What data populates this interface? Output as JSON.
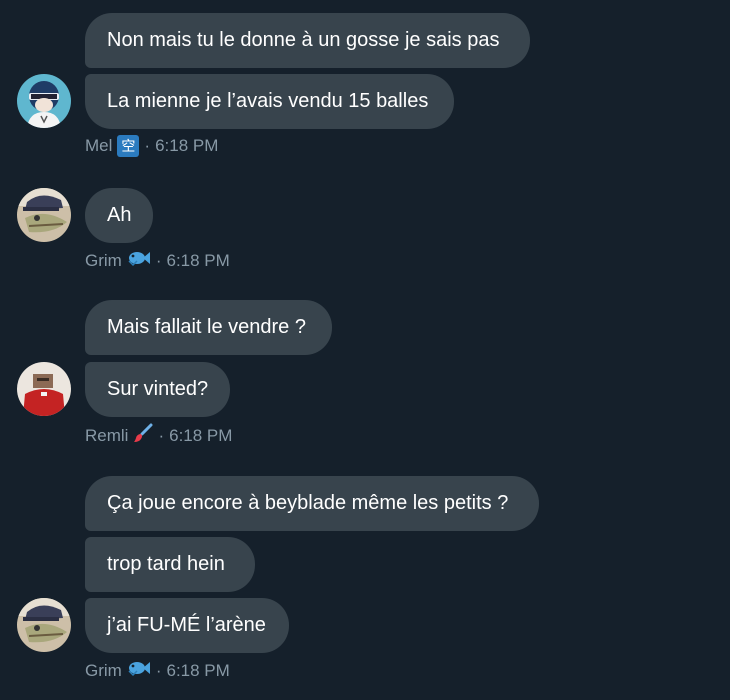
{
  "messages": [
    {
      "author": "Mel",
      "author_emoji": "空",
      "time": "6:18 PM",
      "texts": [
        "Non mais tu le donne à un gosse je sais pas",
        "La mienne je l’avais vendu 15 balles"
      ]
    },
    {
      "author": "Grim",
      "author_emoji": "fish",
      "time": "6:18 PM",
      "texts": [
        "Ah"
      ]
    },
    {
      "author": "Remli",
      "author_emoji": "paintbrush",
      "time": "6:18 PM",
      "texts": [
        "Mais fallait le vendre ?",
        "Sur vinted?"
      ]
    },
    {
      "author": "Grim",
      "author_emoji": "fish",
      "time": "6:18 PM",
      "texts": [
        "Ça joue encore à beyblade même les petits ?",
        "trop tard hein",
        "j’ai FU-MÉ l’arène"
      ]
    }
  ],
  "separator": "·"
}
